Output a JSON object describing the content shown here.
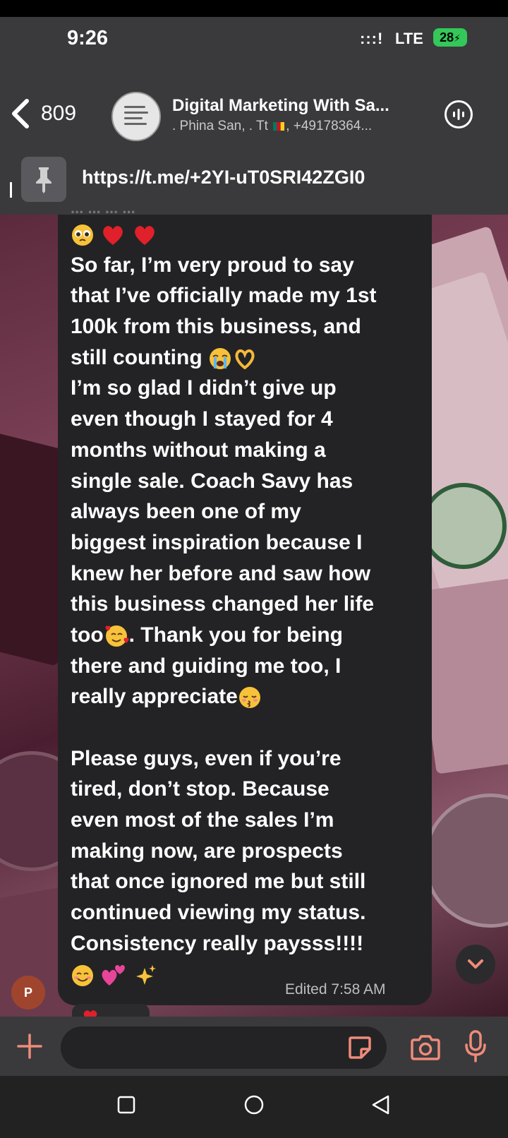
{
  "status_bar": {
    "time": "9:26",
    "signal": ":::!",
    "network": "LTE",
    "battery": "28"
  },
  "header": {
    "back_count": "809",
    "title": "Digital Marketing With Sa...",
    "subtitle_before_flag": ". Phina San, . Tt ",
    "subtitle_after_flag": ", +49178364..."
  },
  "pinned": {
    "link": "https://t.me/+2YI-uT0SRI42ZGI0"
  },
  "message": {
    "cut_line": "... ... ... ...",
    "lines": [
      "",
      "So far, I’m very proud to say",
      "that I’ve officially made my 1st",
      "100k from this business, and",
      "still counting ",
      "I’m so glad I didn’t give up",
      "even though I stayed for 4",
      "months without making a",
      "single sale. Coach Savy has",
      "always been one of my",
      "biggest inspiration because I",
      "knew her before and saw how",
      "this business changed her life",
      "too",
      ". Thank you for being",
      "there and guiding me too, I",
      "really appreciate",
      "Please guys, even if you’re",
      "tired, don’t stop. Because",
      "even most of the sales I’m",
      "making now, are prospects",
      "that once ignored me but still",
      "continued viewing my status.",
      "Consistency really paysss!!!!"
    ],
    "edited_label": "Edited",
    "time": "7:58 AM"
  },
  "sender_avatar": "P",
  "icons": {
    "back": "chevron-left-icon",
    "call": "voice-chat-icon",
    "pin": "pin-icon",
    "scroll": "chevron-down-icon",
    "attach": "plus-icon",
    "sticker": "sticker-icon",
    "camera": "camera-icon",
    "mic": "microphone-icon"
  },
  "colors": {
    "header_bg": "#3a3a3c",
    "bubble_bg": "#232325",
    "battery": "#34c759",
    "avatar": "#a0452d"
  }
}
